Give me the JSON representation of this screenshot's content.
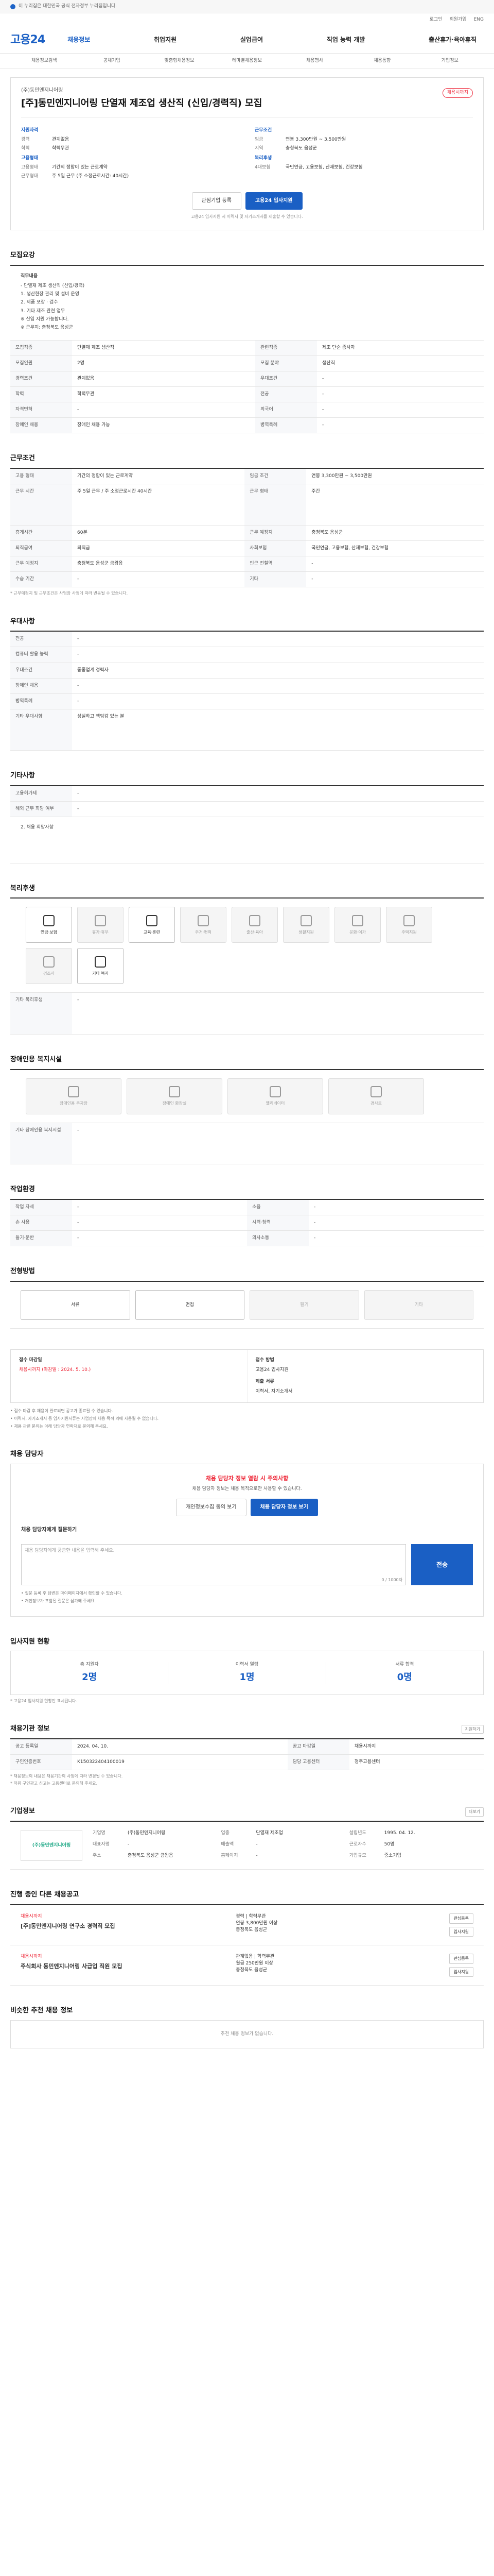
{
  "banner": {
    "text": "이 누리집은 대한민국 공식 전자정부 누리집입니다."
  },
  "util": {
    "links": [
      "로그인",
      "회원가입",
      "ENG"
    ]
  },
  "gnb": {
    "logo": "고용24",
    "menu": [
      "채용정보",
      "취업지원",
      "실업급여",
      "직업 능력 개발",
      "출산휴가·육아휴직"
    ]
  },
  "subnav": [
    "채용정보검색",
    "공채기업",
    "맞춤형채용정보",
    "테마별채용정보",
    "채용행사",
    "채용동향",
    "기업정보"
  ],
  "job": {
    "company": "(주)동민엔지니어링",
    "dday": "채용시까지",
    "title": "[주]동민엔지니어링 단열재 제조업 생산직 (신입/경력직) 모집",
    "left_heading": "지원자격",
    "left": [
      {
        "k": "경력",
        "v": "관계없음"
      },
      {
        "k": "학력",
        "v": "학력무관"
      }
    ],
    "left2_heading": "고용형태",
    "left2": [
      {
        "k": "고용형태",
        "v": "기간의 정함이 있는 근로계약"
      },
      {
        "k": "근무형태",
        "v": "주 5일 근무 (주 소정근로시간: 40시간)"
      }
    ],
    "right_heading": "근무조건",
    "right": [
      {
        "k": "임금",
        "v": "연봉 3,300만원 ~ 3,500만원"
      },
      {
        "k": "지역",
        "v": "충청북도 음성군"
      }
    ],
    "right2_heading": "복리후생",
    "right2": [
      {
        "k": "4대보험",
        "v": "국민연금, 고용보험, 산재보험, 건강보험"
      }
    ],
    "btn_interest": "관심기업 등록",
    "btn_apply": "고용24 입사지원",
    "notice": "고용24 입사지원 시 이력서 및 자기소개서를 제출할 수 있습니다."
  },
  "sections": {
    "job_desc": {
      "title": "모집요강",
      "desc_heading": "직무내용",
      "desc_lines": [
        "- 단열재 제조 생산직 (신입/경력)",
        "1. 생산현장 관리 및 설비 운영",
        "2. 제품 포장 · 검수",
        "3. 기타 제조 관련 업무",
        "※ 신입 지원 가능합니다.",
        "※ 근무지: 충청북도 음성군"
      ],
      "rows": [
        {
          "k": "모집직종",
          "v": "단열재 제조 생산직",
          "k2": "관련직종",
          "v2": "제조 단순 종사자"
        },
        {
          "k": "모집인원",
          "v": "2명",
          "k2": "모집 분야",
          "v2": "생산직"
        },
        {
          "k": "경력조건",
          "v": "관계없음",
          "k2": "우대조건",
          "v2": "-"
        },
        {
          "k": "학력",
          "v": "학력무관",
          "k2": "전공",
          "v2": "-"
        },
        {
          "k": "자격면허",
          "v": "-",
          "k2": "외국어",
          "v2": "-"
        },
        {
          "k": "장애인 채용",
          "v": "장애인 채용 가능",
          "k2": "병역특례",
          "v2": "-"
        }
      ]
    },
    "conditions": {
      "title": "근무조건",
      "rows": [
        {
          "k": "고용 형태",
          "v": "기간의 정함이 있는 근로계약",
          "k2": "임금 조건",
          "v2": "연봉 3,300만원 ~ 3,500만원"
        },
        {
          "k": "근무 시간",
          "v": "주 5일 근무 / 주 소정근로시간 40시간",
          "k2": "근무 형태",
          "v2": "주간"
        },
        {
          "k": "휴게시간",
          "v": "60분",
          "k2": "근무 예정지",
          "v2": "충청북도 음성군"
        },
        {
          "k": "퇴직급여",
          "v": "퇴직금",
          "k2": "사회보험",
          "v2": "국민연금, 고용보험, 산재보험, 건강보험"
        },
        {
          "k": "근무 예정지",
          "v": "충청북도 음성군 금왕읍",
          "k2": "인근 전철역",
          "v2": "-"
        },
        {
          "k": "수습 기간",
          "v": "-",
          "k2": "기타",
          "v2": "-"
        }
      ],
      "note": "* 근무예정지 및 근무조건은 사업장 사정에 따라 변동될 수 있습니다."
    },
    "preference": {
      "title": "우대사항",
      "rows": [
        {
          "k": "전공",
          "v": "-"
        },
        {
          "k": "컴퓨터 활용 능력",
          "v": "-"
        },
        {
          "k": "우대조건",
          "v": "동종업계 경력자"
        },
        {
          "k": "장애인 채용",
          "v": "-"
        },
        {
          "k": "병역특례",
          "v": "-"
        },
        {
          "k": "기타 우대사항",
          "v": "성실하고 책임감 있는 분"
        }
      ]
    },
    "other_info": {
      "title": "기타사항",
      "rows": [
        {
          "k": "고용허가제",
          "v": "-"
        },
        {
          "k": "해외 근무 희망 여부",
          "v": "-"
        }
      ],
      "extra": "2. 채용 희망사항"
    },
    "welfare": {
      "title": "복리후생",
      "items": [
        "연금·보험",
        "휴가·휴무",
        "교육·훈련",
        "주거·편의",
        "출산·육아",
        "생활지원",
        "문화·여가",
        "주택지원",
        "경조사",
        "기타 복지"
      ],
      "extra_title": "기타 복리후생",
      "extra": "-"
    },
    "disabled_env": {
      "title": "장애인용 복지시설",
      "items": [
        "장애인용 주차장",
        "장애인 화장실",
        "엘리베이터",
        "경사로"
      ],
      "extra_title": "기타 장애인용 복지시설",
      "extra": "-"
    },
    "workplace": {
      "title": "작업환경",
      "rows": [
        {
          "k": "작업 자세",
          "v": "-",
          "k2": "소음",
          "v2": "-"
        },
        {
          "k": "손 사용",
          "v": "-",
          "k2": "시력·청력",
          "v2": "-"
        },
        {
          "k": "들기·운반",
          "v": "-",
          "k2": "의사소통",
          "v2": "-"
        }
      ]
    },
    "selection": {
      "title": "전형방법",
      "items": [
        "서류",
        "면접",
        "필기",
        "기타"
      ]
    },
    "apply": {
      "title": "접수 마감일",
      "deadline": "채용시까지 (마감일 : 2024. 5. 10.)",
      "method_title": "접수 방법",
      "method": "고용24 입사지원",
      "docs_title": "제출 서류",
      "docs": "이력서, 자기소개서",
      "notes": [
        "접수 마감 후 채용이 완료되면 공고가 종료될 수 있습니다.",
        "이력서, 자기소개서 등 입사지원서류는 사업장의 채용 목적 외에 사용될 수 없습니다.",
        "채용 관련 문의는 아래 담당자 연락처로 문의해 주세요."
      ]
    },
    "contact": {
      "title": "채용 담당자",
      "warn": "채용 담당자 정보 열람 시 주의사항",
      "sub": "채용 담당자 정보는 채용 목적으로만 사용할 수 있습니다.",
      "btn1": "개인정보수집 동의 보기",
      "btn2": "채용 담당자 정보 보기",
      "q_title": "채용 담당자에게 질문하기",
      "q_placeholder": "채용 담당자에게 궁금한 내용을 입력해 주세요.",
      "q_count": "0 / 1000자",
      "q_btn": "전송",
      "notes": [
        "질문 등록 후 답변은 마이페이지에서 확인할 수 있습니다.",
        "개인정보가 포함된 질문은 삼가해 주세요."
      ]
    },
    "status": {
      "title": "입사지원 현황",
      "stats": [
        {
          "lbl": "총 지원자",
          "val": "2명"
        },
        {
          "lbl": "이력서 열람",
          "val": "1명"
        },
        {
          "lbl": "서류 합격",
          "val": "0명"
        }
      ],
      "note": "* 고용24 입사지원 현황만 표시됩니다."
    },
    "registration": {
      "title": "채용기관 정보",
      "more": "지원하기",
      "rows": [
        {
          "k": "공고 등록일",
          "v": "2024. 04. 10.",
          "k2": "공고 마감일",
          "v2": "채용시까지"
        },
        {
          "k": "구인인증번호",
          "v": "K150322404100019",
          "k2": "담당 고용센터",
          "v2": "청주고용센터"
        }
      ],
      "notes": [
        "* 채용정보의 내용은 채용기관의 사정에 따라 변경될 수 있습니다.",
        "* 허위 구인광고 신고는 고용센터로 문의해 주세요."
      ]
    },
    "company": {
      "title": "기업정보",
      "more": "더보기",
      "logo_text": "(주)동민엔지니어링",
      "info": [
        {
          "k": "기업명",
          "v": "(주)동민엔지니어링"
        },
        {
          "k": "업종",
          "v": "단열재 제조업"
        },
        {
          "k": "설립년도",
          "v": "1995. 04. 12."
        },
        {
          "k": "대표자명",
          "v": "-"
        },
        {
          "k": "매출액",
          "v": "-"
        },
        {
          "k": "근로자수",
          "v": "50명"
        },
        {
          "k": "주소",
          "v": "충청북도 음성군 금왕읍"
        },
        {
          "k": "홈페이지",
          "v": "-"
        },
        {
          "k": "기업규모",
          "v": "중소기업"
        }
      ]
    },
    "other_jobs": {
      "title": "진행 중인 다른 채용공고",
      "jobs": [
        {
          "tag": "채용시까지",
          "title": "[주]동민엔지니어링 연구소 경력직 모집",
          "cond1": "경력 | 학력무관",
          "cond2": "연봉 3,800만원 이상",
          "cond3": "충청북도 음성군",
          "b1": "관심등록",
          "b2": "입사지원"
        },
        {
          "tag": "채용시까지",
          "title": "주식회사 동민엔지니어링 사급업 직원 모집",
          "cond1": "관계없음 | 학력무관",
          "cond2": "월급 250만원 이상",
          "cond3": "충청북도 음성군",
          "b1": "관심등록",
          "b2": "입사지원"
        }
      ]
    },
    "similar": {
      "title": "비슷한 추천 채용 정보",
      "empty": "추천 채용 정보가 없습니다."
    }
  }
}
